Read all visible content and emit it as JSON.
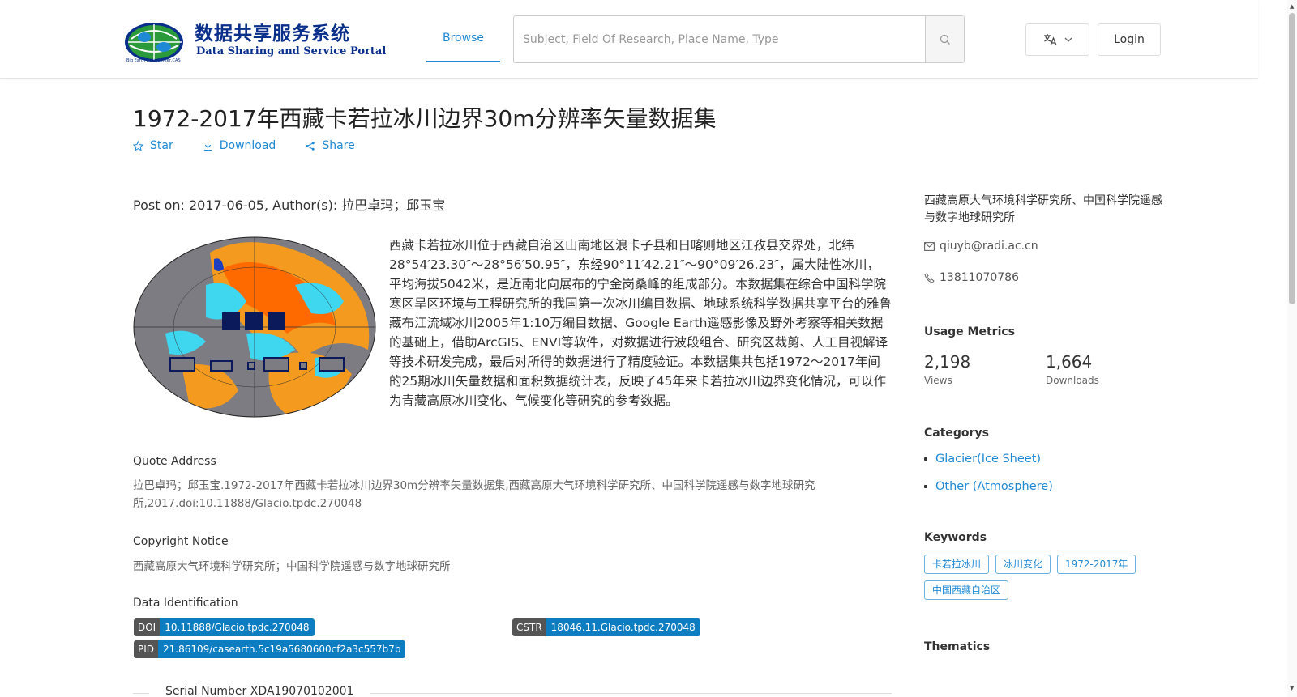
{
  "header": {
    "logo_title": "数据共享服务系统",
    "logo_subtitle": "Data Sharing and Service Portal",
    "logo_small_text": "Big Earth Data Center,CAS",
    "nav_browse": "Browse",
    "search_placeholder": "Subject, Field Of Research, Place Name, Type",
    "login": "Login",
    "lang_icon": "translate-icon"
  },
  "dataset": {
    "title": "1972-2017年西藏卡若拉冰川边界30m分辨率矢量数据集",
    "actions": {
      "star": "Star",
      "download": "Download",
      "share": "Share"
    },
    "post_on": "Post on: 2017-06-05, Author(s): 拉巴卓玛；邱玉宝",
    "description": "西藏卡若拉冰川位于西藏自治区山南地区浪卡子县和日喀则地区江孜县交界处，北纬28°54′23.30″～28°56′50.95″，东经90°11′42.21″～90°09′26.23″，属大陆性冰川，平均海拔5042米，是近南北向展布的宁金岗桑峰的组成部分。本数据集在综合中国科学院寒区旱区环境与工程研究所的我国第一次冰川编目数据、地球系统科学数据共享平台的雅鲁藏布江流域冰川2005年1:10万编目数据、Google Earth遥感影像及野外考察等相关数据的基础上，借助ArcGIS、ENVI等软件，对数据进行波段组合、研究区裁剪、人工目视解译等技术研发完成，最后对所得的数据进行了精度验证。本数据集共包括1972～2017年间的25期冰川矢量数据和面积数据统计表，反映了45年来卡若拉冰川边界变化情况，可以作为青藏高原冰川变化、气候变化等研究的参考数据。",
    "quote_heading": "Quote Address",
    "quote_text": "拉巴卓玛；邱玉宝.1972-2017年西藏卡若拉冰川边界30m分辨率矢量数据集,西藏高原大气环境科学研究所、中国科学院遥感与数字地球研究所,2017.doi:10.11888/Glacio.tpdc.270048",
    "copyright_heading": "Copyright Notice",
    "copyright_text": "西藏高原大气环境科学研究所；中国科学院遥感与数字地球研究所",
    "identification_heading": "Data Identification",
    "ids": {
      "doi_key": "DOI",
      "doi_val": "10.11888/Glacio.tpdc.270048",
      "cstr_key": "CSTR",
      "cstr_val": "18046.11.Glacio.tpdc.270048",
      "pid_key": "PID",
      "pid_val": "21.86109/casearth.5c19a5680600cf2a3c557b7b"
    },
    "serial": "Serial Number XDA19070102001"
  },
  "sidebar": {
    "organization": "西藏高原大气环境科学研究所、中国科学院遥感与数字地球研究所",
    "email": "qiuyb@radi.ac.cn",
    "phone": "13811070786",
    "metrics_heading": "Usage Metrics",
    "views": "2,198",
    "views_label": "Views",
    "downloads": "1,664",
    "downloads_label": "Downloads",
    "categories_heading": "Categorys",
    "categories": [
      "Glacier(Ice Sheet)",
      "Other (Atmosphere)"
    ],
    "keywords_heading": "Keywords",
    "keywords": [
      "卡若拉冰川",
      "冰川变化",
      "1972-2017年",
      "中国西藏自治区"
    ],
    "thematics_heading": "Thematics"
  },
  "colors": {
    "accent": "#1f89d4",
    "badge_key": "#555555",
    "badge_value": "#0d7dc2",
    "logo": "#0a2f8a"
  }
}
